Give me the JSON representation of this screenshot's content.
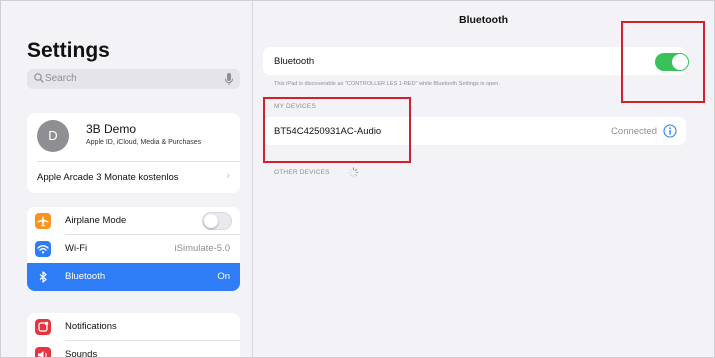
{
  "sidebar": {
    "title": "Settings",
    "search": {
      "placeholder": "Search"
    },
    "profile": {
      "initial": "D",
      "name": "3B Demo",
      "subtitle": "Apple ID, iCloud, Media & Purchases"
    },
    "arcade": {
      "label": "Apple Arcade 3 Monate kostenlos"
    },
    "connectivity": [
      {
        "label": "Airplane Mode",
        "icon": "airplane-icon",
        "color": "#f7931e",
        "toggle": false
      },
      {
        "label": "Wi-Fi",
        "value": "iSimulate-5.0",
        "icon": "wifi-icon",
        "color": "#2f7df6"
      },
      {
        "label": "Bluetooth",
        "value": "On",
        "icon": "bluetooth-icon",
        "color": "#2f7df6",
        "selected": true
      }
    ],
    "notifications_group": [
      {
        "label": "Notifications",
        "icon": "notifications-icon",
        "color": "#e5353f"
      },
      {
        "label": "Sounds",
        "icon": "sounds-icon",
        "color": "#e5353f"
      }
    ]
  },
  "main": {
    "title": "Bluetooth",
    "bluetooth_toggle": {
      "label": "Bluetooth",
      "on": true,
      "color": "#3ac25a"
    },
    "discoverable_note": "This iPad is discoverable as \"CONTROLLER LES 1-RED\" while Bluetooth Settings is open.",
    "my_devices_header": "MY DEVICES",
    "devices": [
      {
        "name": "BT54C4250931AC-Audio",
        "status": "Connected"
      }
    ],
    "other_devices_header": "OTHER DEVICES"
  },
  "colors": {
    "accent": "#2f7df6",
    "highlight": "#d21f2a"
  }
}
